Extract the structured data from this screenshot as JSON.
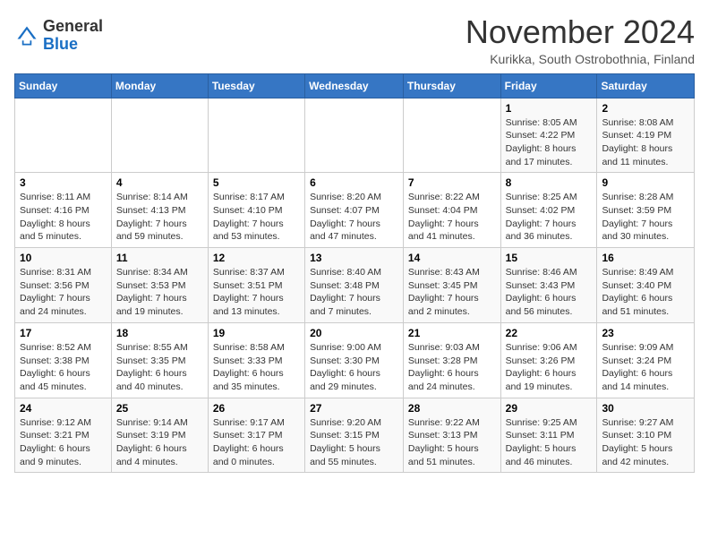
{
  "logo": {
    "general": "General",
    "blue": "Blue"
  },
  "header": {
    "month_year": "November 2024",
    "location": "Kurikka, South Ostrobothnia, Finland"
  },
  "days_of_week": [
    "Sunday",
    "Monday",
    "Tuesday",
    "Wednesday",
    "Thursday",
    "Friday",
    "Saturday"
  ],
  "weeks": [
    [
      {
        "day": "",
        "info": ""
      },
      {
        "day": "",
        "info": ""
      },
      {
        "day": "",
        "info": ""
      },
      {
        "day": "",
        "info": ""
      },
      {
        "day": "",
        "info": ""
      },
      {
        "day": "1",
        "info": "Sunrise: 8:05 AM\nSunset: 4:22 PM\nDaylight: 8 hours and 17 minutes."
      },
      {
        "day": "2",
        "info": "Sunrise: 8:08 AM\nSunset: 4:19 PM\nDaylight: 8 hours and 11 minutes."
      }
    ],
    [
      {
        "day": "3",
        "info": "Sunrise: 8:11 AM\nSunset: 4:16 PM\nDaylight: 8 hours and 5 minutes."
      },
      {
        "day": "4",
        "info": "Sunrise: 8:14 AM\nSunset: 4:13 PM\nDaylight: 7 hours and 59 minutes."
      },
      {
        "day": "5",
        "info": "Sunrise: 8:17 AM\nSunset: 4:10 PM\nDaylight: 7 hours and 53 minutes."
      },
      {
        "day": "6",
        "info": "Sunrise: 8:20 AM\nSunset: 4:07 PM\nDaylight: 7 hours and 47 minutes."
      },
      {
        "day": "7",
        "info": "Sunrise: 8:22 AM\nSunset: 4:04 PM\nDaylight: 7 hours and 41 minutes."
      },
      {
        "day": "8",
        "info": "Sunrise: 8:25 AM\nSunset: 4:02 PM\nDaylight: 7 hours and 36 minutes."
      },
      {
        "day": "9",
        "info": "Sunrise: 8:28 AM\nSunset: 3:59 PM\nDaylight: 7 hours and 30 minutes."
      }
    ],
    [
      {
        "day": "10",
        "info": "Sunrise: 8:31 AM\nSunset: 3:56 PM\nDaylight: 7 hours and 24 minutes."
      },
      {
        "day": "11",
        "info": "Sunrise: 8:34 AM\nSunset: 3:53 PM\nDaylight: 7 hours and 19 minutes."
      },
      {
        "day": "12",
        "info": "Sunrise: 8:37 AM\nSunset: 3:51 PM\nDaylight: 7 hours and 13 minutes."
      },
      {
        "day": "13",
        "info": "Sunrise: 8:40 AM\nSunset: 3:48 PM\nDaylight: 7 hours and 7 minutes."
      },
      {
        "day": "14",
        "info": "Sunrise: 8:43 AM\nSunset: 3:45 PM\nDaylight: 7 hours and 2 minutes."
      },
      {
        "day": "15",
        "info": "Sunrise: 8:46 AM\nSunset: 3:43 PM\nDaylight: 6 hours and 56 minutes."
      },
      {
        "day": "16",
        "info": "Sunrise: 8:49 AM\nSunset: 3:40 PM\nDaylight: 6 hours and 51 minutes."
      }
    ],
    [
      {
        "day": "17",
        "info": "Sunrise: 8:52 AM\nSunset: 3:38 PM\nDaylight: 6 hours and 45 minutes."
      },
      {
        "day": "18",
        "info": "Sunrise: 8:55 AM\nSunset: 3:35 PM\nDaylight: 6 hours and 40 minutes."
      },
      {
        "day": "19",
        "info": "Sunrise: 8:58 AM\nSunset: 3:33 PM\nDaylight: 6 hours and 35 minutes."
      },
      {
        "day": "20",
        "info": "Sunrise: 9:00 AM\nSunset: 3:30 PM\nDaylight: 6 hours and 29 minutes."
      },
      {
        "day": "21",
        "info": "Sunrise: 9:03 AM\nSunset: 3:28 PM\nDaylight: 6 hours and 24 minutes."
      },
      {
        "day": "22",
        "info": "Sunrise: 9:06 AM\nSunset: 3:26 PM\nDaylight: 6 hours and 19 minutes."
      },
      {
        "day": "23",
        "info": "Sunrise: 9:09 AM\nSunset: 3:24 PM\nDaylight: 6 hours and 14 minutes."
      }
    ],
    [
      {
        "day": "24",
        "info": "Sunrise: 9:12 AM\nSunset: 3:21 PM\nDaylight: 6 hours and 9 minutes."
      },
      {
        "day": "25",
        "info": "Sunrise: 9:14 AM\nSunset: 3:19 PM\nDaylight: 6 hours and 4 minutes."
      },
      {
        "day": "26",
        "info": "Sunrise: 9:17 AM\nSunset: 3:17 PM\nDaylight: 6 hours and 0 minutes."
      },
      {
        "day": "27",
        "info": "Sunrise: 9:20 AM\nSunset: 3:15 PM\nDaylight: 5 hours and 55 minutes."
      },
      {
        "day": "28",
        "info": "Sunrise: 9:22 AM\nSunset: 3:13 PM\nDaylight: 5 hours and 51 minutes."
      },
      {
        "day": "29",
        "info": "Sunrise: 9:25 AM\nSunset: 3:11 PM\nDaylight: 5 hours and 46 minutes."
      },
      {
        "day": "30",
        "info": "Sunrise: 9:27 AM\nSunset: 3:10 PM\nDaylight: 5 hours and 42 minutes."
      }
    ]
  ]
}
